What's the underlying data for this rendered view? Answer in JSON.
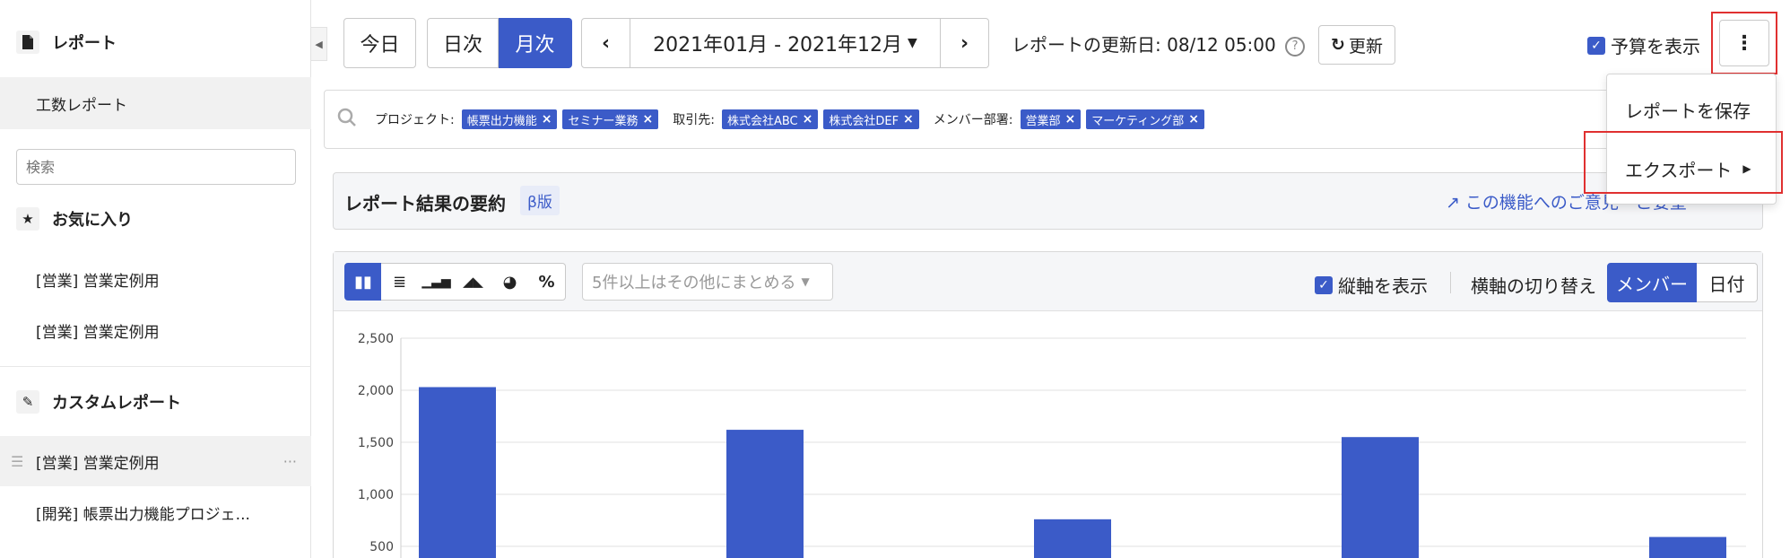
{
  "sidebar": {
    "report_heading": "レポート",
    "effort_report": "工数レポート",
    "search_placeholder": "検索",
    "favorites_heading": "お気に入り",
    "favorites": [
      "[営業] 営業定例用",
      "[営業] 営業定例用"
    ],
    "custom_heading": "カスタムレポート",
    "custom_items": [
      "[営業] 営業定例用",
      "[開発] 帳票出力機能プロジェ..."
    ],
    "more_icon": "···"
  },
  "toolbar": {
    "today": "今日",
    "daily": "日次",
    "monthly": "月次",
    "range": "2021年01月 - 2021年12月",
    "updated_label": "レポートの更新日: 08/12 05:00",
    "refresh_label": "更新",
    "show_budget_label": "予算を表示"
  },
  "filters": {
    "project_label": "プロジェクト:",
    "project_tags": [
      "帳票出力機能",
      "セミナー業務"
    ],
    "client_label": "取引先:",
    "client_tags": [
      "株式会社ABC",
      "株式会社DEF"
    ],
    "dept_label": "メンバー部署:",
    "dept_tags": [
      "営業部",
      "マーケティング部"
    ]
  },
  "summary": {
    "title": "レポート結果の要約",
    "beta": "β版",
    "feedback": "この機能へのご意見・ご要望"
  },
  "chart_tools": {
    "group_others": "5件以上はその他にまとめる",
    "show_axis": "縦軸を表示",
    "axis_switch_label": "横軸の切り替え",
    "axis_member": "メンバー",
    "axis_date": "日付"
  },
  "menu": {
    "save": "レポートを保存",
    "export": "エクスポート"
  },
  "chart_data": {
    "type": "bar",
    "y_ticks": [
      "2,500",
      "2,000",
      "1,500",
      "1,000",
      "500"
    ],
    "ylim": [
      0,
      2500
    ],
    "values": [
      2030,
      1620,
      760,
      1550,
      590
    ]
  },
  "colors": {
    "accent": "#3b5bc8",
    "highlight": "#e03030"
  }
}
